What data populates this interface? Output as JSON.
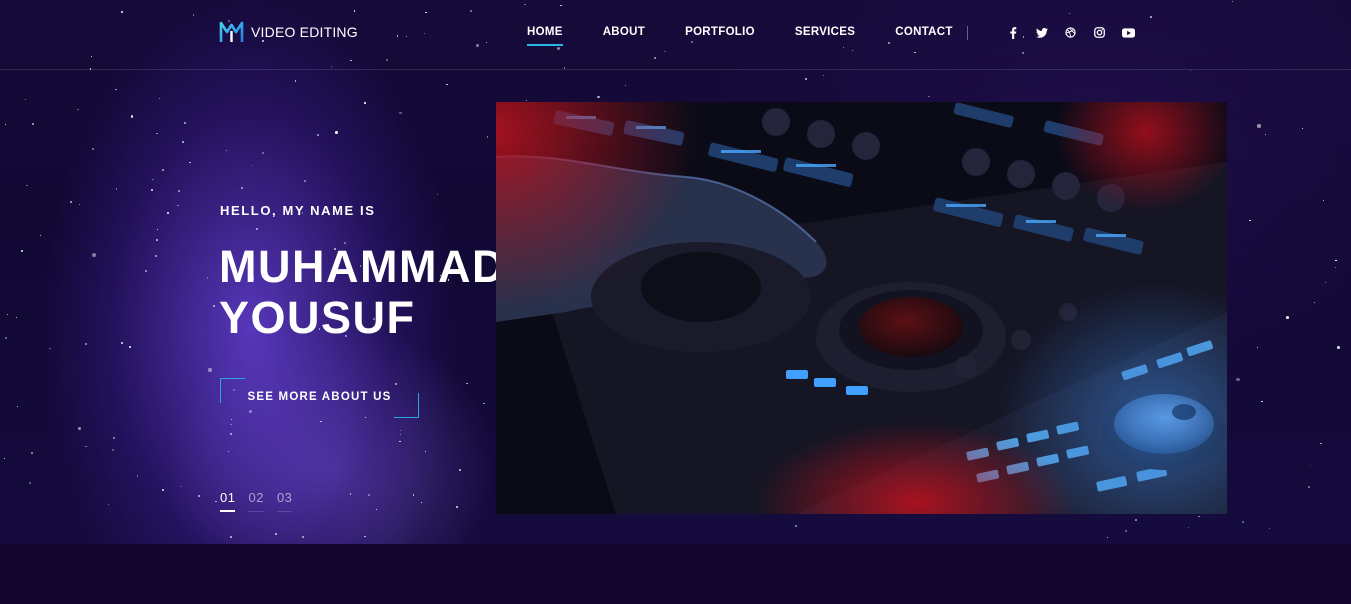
{
  "header": {
    "logo_text": "VIDEO EDITING",
    "nav": [
      {
        "label": "HOME",
        "active": true
      },
      {
        "label": "ABOUT",
        "active": false
      },
      {
        "label": "PORTFOLIO",
        "active": false
      },
      {
        "label": "SERVICES",
        "active": false
      },
      {
        "label": "CONTACT",
        "active": false
      }
    ],
    "social_icons": [
      "facebook-icon",
      "twitter-icon",
      "dribbble-icon",
      "instagram-icon",
      "youtube-icon"
    ]
  },
  "hero": {
    "greeting": "HELLO, MY NAME IS",
    "name_line1": "MUHAMMAD",
    "name_line2": "YOUSUF",
    "cta_label": "SEE MORE ABOUT US",
    "slides": [
      "01",
      "02",
      "03"
    ],
    "active_slide": "01",
    "image_subject": "video editing control panel"
  },
  "colors": {
    "accent": "#28b7e8",
    "background_dark": "#12052e",
    "nebula_purple": "#6e46e6"
  }
}
